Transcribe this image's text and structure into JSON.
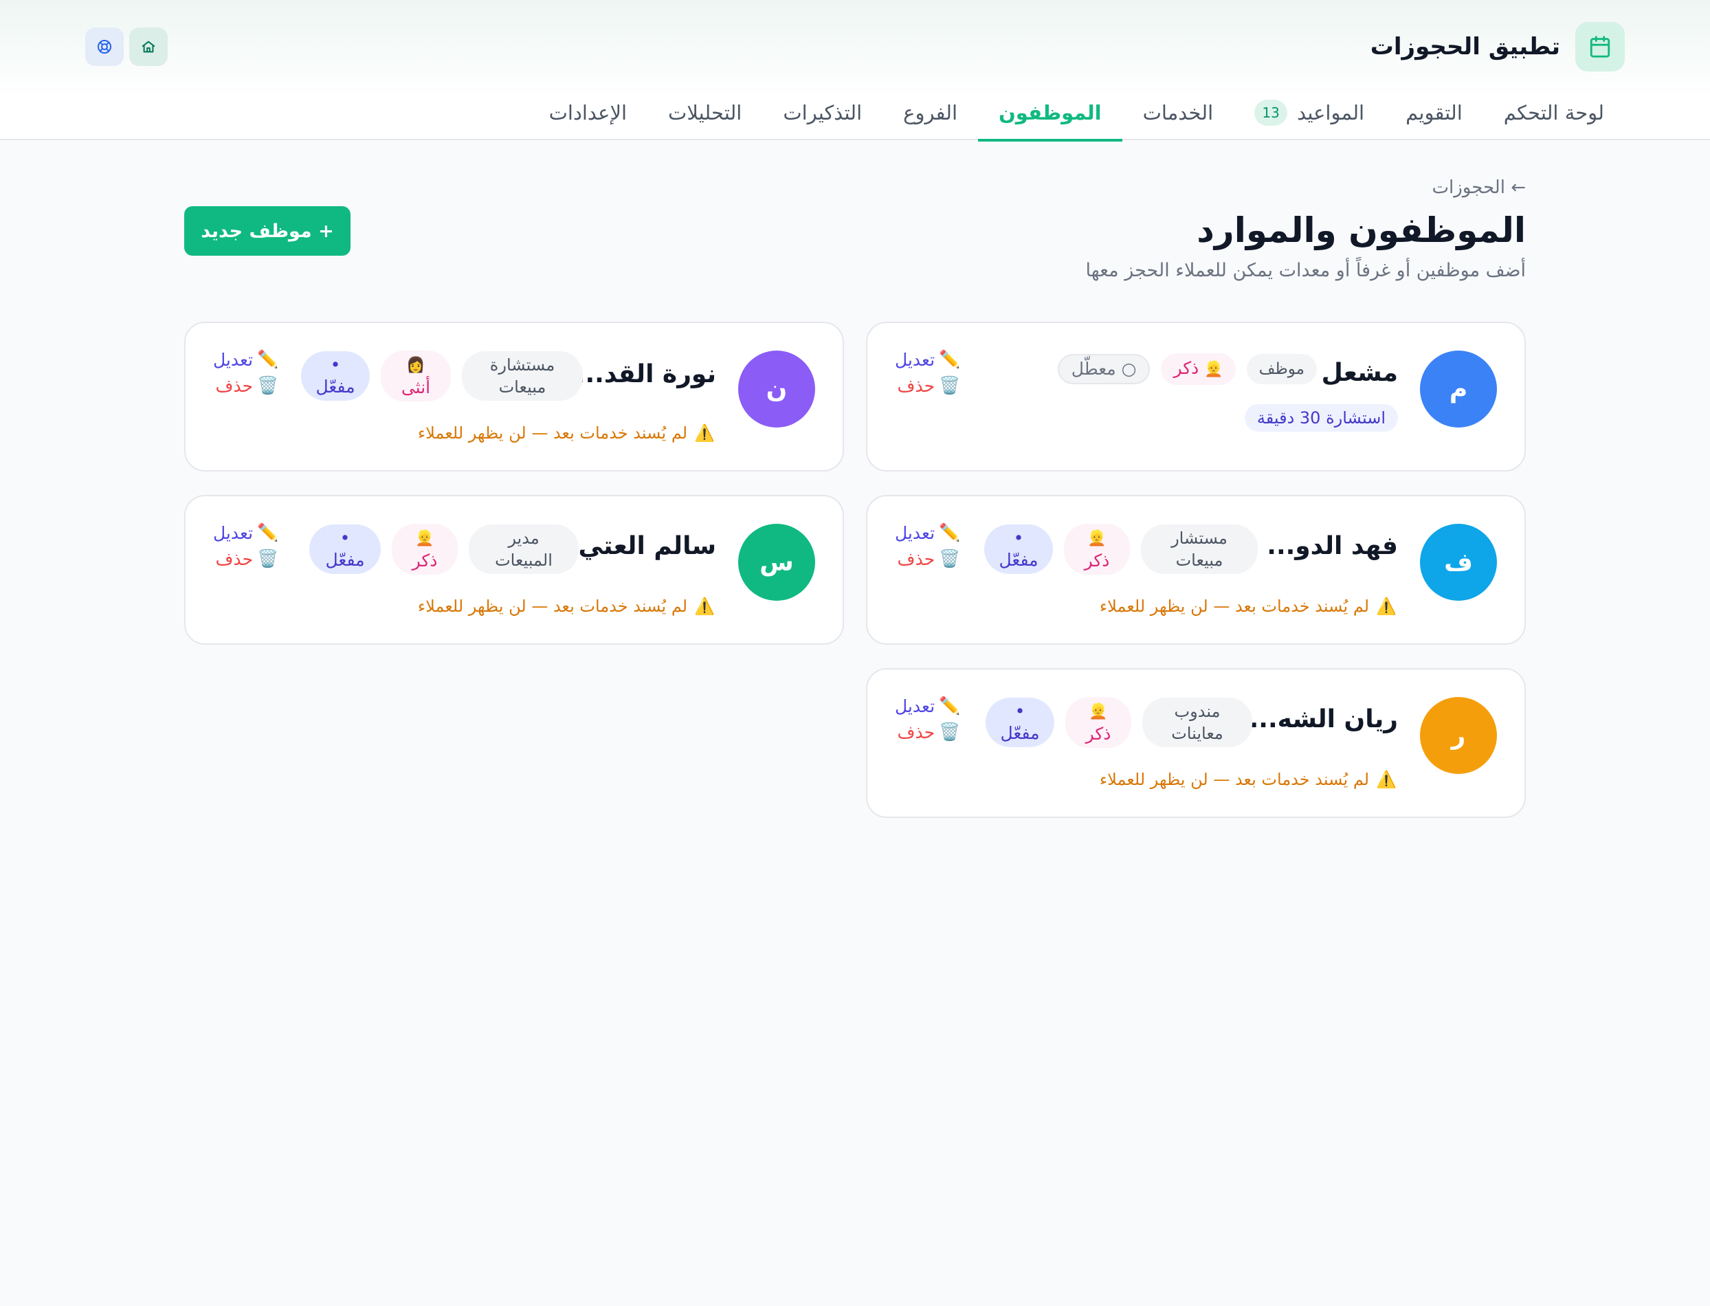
{
  "app": {
    "title": "تطبيق الحجوزات"
  },
  "nav": [
    {
      "label": "لوحة التحكم"
    },
    {
      "label": "التقويم"
    },
    {
      "label": "المواعيد",
      "badge": "13"
    },
    {
      "label": "الخدمات"
    },
    {
      "label": "الموظفون",
      "active": true
    },
    {
      "label": "الفروع"
    },
    {
      "label": "التذكيرات"
    },
    {
      "label": "التحليلات"
    },
    {
      "label": "الإعدادات"
    }
  ],
  "page": {
    "back": "← الحجوزات",
    "title": "الموظفون والموارد",
    "subtitle": "أضف موظفين أو غرفاً أو معدات يمكن للعملاء الحجز معها",
    "new_button": "+ موظف جديد"
  },
  "actions": {
    "edit": "تعديل",
    "delete": "حذف",
    "edit_icon": "pencil-icon",
    "delete_icon": "trash-icon"
  },
  "warning_text": "لم يُسند خدمات بعد — لن يظهر للعملاء",
  "staff": [
    {
      "initial": "م",
      "name": "مشعل",
      "role": "موظف",
      "gender": "ذكر",
      "gender_emoji": "👱",
      "status": "معطّل",
      "status_active": false,
      "service": "استشارة 30 دقيقة",
      "color": "#3b82f6"
    },
    {
      "initial": "ن",
      "name": "نورة القد...",
      "role_line1": "مستشارة",
      "role_line2": "مبيعات",
      "gender": "أنثى",
      "gender_emoji": "👩",
      "status": "مفعّل",
      "status_active": true,
      "color": "#8b5cf6"
    },
    {
      "initial": "ف",
      "name": "فهد الدو...",
      "role_line1": "مستشار",
      "role_line2": "مبيعات",
      "gender": "ذكر",
      "gender_emoji": "👱",
      "status": "مفعّل",
      "status_active": true,
      "color": "#0ea5e9"
    },
    {
      "initial": "س",
      "name": "سالم العتي...",
      "role_line1": "مدير",
      "role_line2": "المبيعات",
      "gender": "ذكر",
      "gender_emoji": "👱",
      "status": "مفعّل",
      "status_active": true,
      "color": "#10b981"
    },
    {
      "initial": "ر",
      "name": "ريان الشه...",
      "role_line1": "مندوب",
      "role_line2": "معاينات",
      "gender": "ذكر",
      "gender_emoji": "👱",
      "status": "مفعّل",
      "status_active": true,
      "color": "#f59e0b"
    }
  ],
  "colors": {
    "accent": "#10b981",
    "edit": "#4f46e5",
    "delete": "#ef4444",
    "warning": "#d97706"
  }
}
